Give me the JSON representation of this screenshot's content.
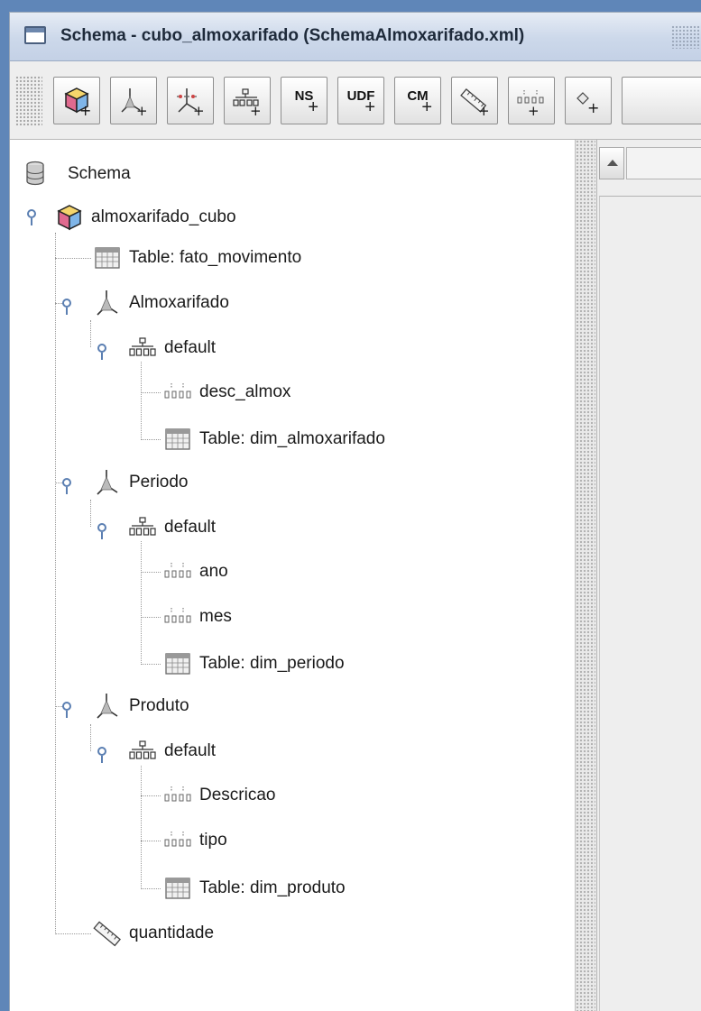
{
  "window": {
    "title": "Schema - cubo_almoxarifado (SchemaAlmoxarifado.xml)"
  },
  "toolbar": {
    "buttons": [
      {
        "icon": "add-cube-icon",
        "text": ""
      },
      {
        "icon": "add-dimension-icon",
        "text": ""
      },
      {
        "icon": "add-dimension-usage-icon",
        "text": ""
      },
      {
        "icon": "add-hierarchy-icon",
        "text": ""
      },
      {
        "icon": "add-named-set-icon",
        "text": "NS"
      },
      {
        "icon": "add-udf-icon",
        "text": "UDF"
      },
      {
        "icon": "add-calculated-member-icon",
        "text": "CM"
      },
      {
        "icon": "add-measure-icon",
        "text": ""
      },
      {
        "icon": "add-level-icon",
        "text": ""
      },
      {
        "icon": "add-property-icon",
        "text": ""
      }
    ]
  },
  "tree": {
    "schema": "Schema",
    "cube": "almoxarifado_cubo",
    "fact_table": "Table: fato_movimento",
    "dimensions": [
      {
        "name": "Almoxarifado",
        "hierarchy": "default",
        "levels": [
          "desc_almox"
        ],
        "table": "Table: dim_almoxarifado"
      },
      {
        "name": "Periodo",
        "hierarchy": "default",
        "levels": [
          "ano",
          "mes"
        ],
        "table": "Table: dim_periodo"
      },
      {
        "name": "Produto",
        "hierarchy": "default",
        "levels": [
          "Descricao",
          "tipo"
        ],
        "table": "Table: dim_produto"
      }
    ],
    "measure": "quantidade"
  }
}
